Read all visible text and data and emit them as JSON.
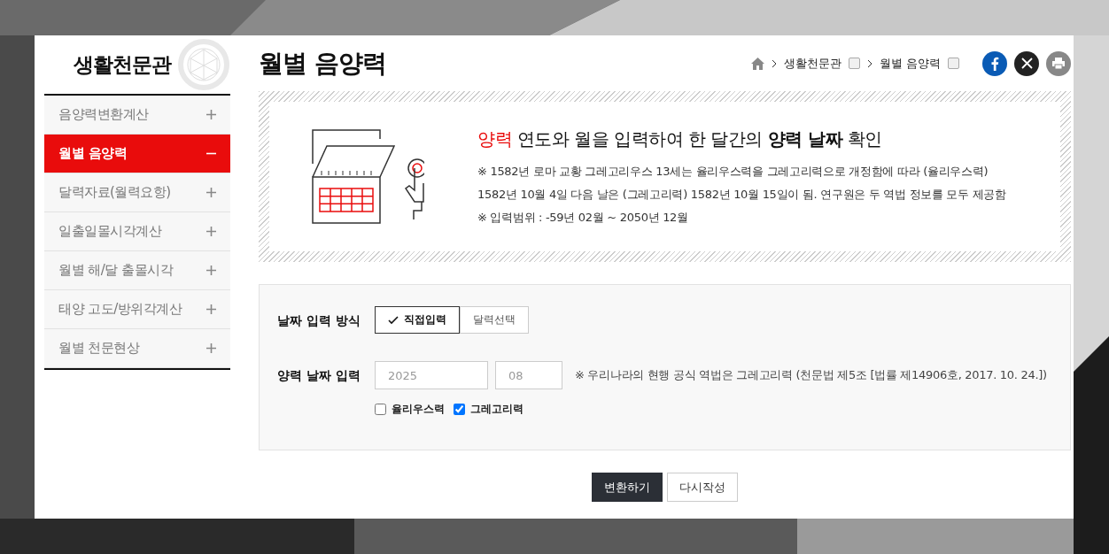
{
  "site": {
    "title": "생활천문관"
  },
  "sidebar": {
    "items": [
      {
        "label": "음양력변환계산",
        "selected": false
      },
      {
        "label": "월별 음양력",
        "selected": true
      },
      {
        "label": "달력자료(월력요항)",
        "selected": false
      },
      {
        "label": "일출일몰시각계산",
        "selected": false
      },
      {
        "label": "월별 해/달 출몰시각",
        "selected": false
      },
      {
        "label": "태양 고도/방위각계산",
        "selected": false
      },
      {
        "label": "월별 천문현상",
        "selected": false
      }
    ]
  },
  "page": {
    "title": "월별 음양력"
  },
  "breadcrumb": [
    "생활천문관",
    "월별 음양력"
  ],
  "info": {
    "heading_accent": "양력",
    "heading": "연도와 월을 입력하여 한 달간의 **양력 날짜** 확인",
    "notes": [
      "※ 1582년 로마 교황 그레고리우스 13세는 율리우스력을 그레고리력으로 개정함에 따라 (율리우스력)",
      "1582년 10월 4일 다음 날은 (그레고리력) 1582년 10월 15일이 됨. 연구원은 두 역법 정보를 모두 제공함",
      "※ 입력범위 : -59년 02월 ~ 2050년 12월"
    ]
  },
  "form": {
    "method_label": "날짜 입력 방식",
    "methods": [
      {
        "label": "직접입력",
        "selected": true
      },
      {
        "label": "달력선택",
        "selected": false
      }
    ],
    "date_label": "양력 날짜 입력",
    "year": {
      "placeholder": "2025"
    },
    "month": {
      "placeholder": "08"
    },
    "note": "※ 우리나라의 현행 공식 역법은 그레고리력 (천문법 제5조 [법률 제14906호, 2017. 10. 24.])",
    "calendars": [
      {
        "label": "율리우스력",
        "checked": false
      },
      {
        "label": "그레고리력",
        "checked": true
      }
    ]
  },
  "buttons": [
    {
      "label": "변환하기",
      "kind": "primary"
    },
    {
      "label": "다시작성",
      "kind": "secondary"
    }
  ]
}
